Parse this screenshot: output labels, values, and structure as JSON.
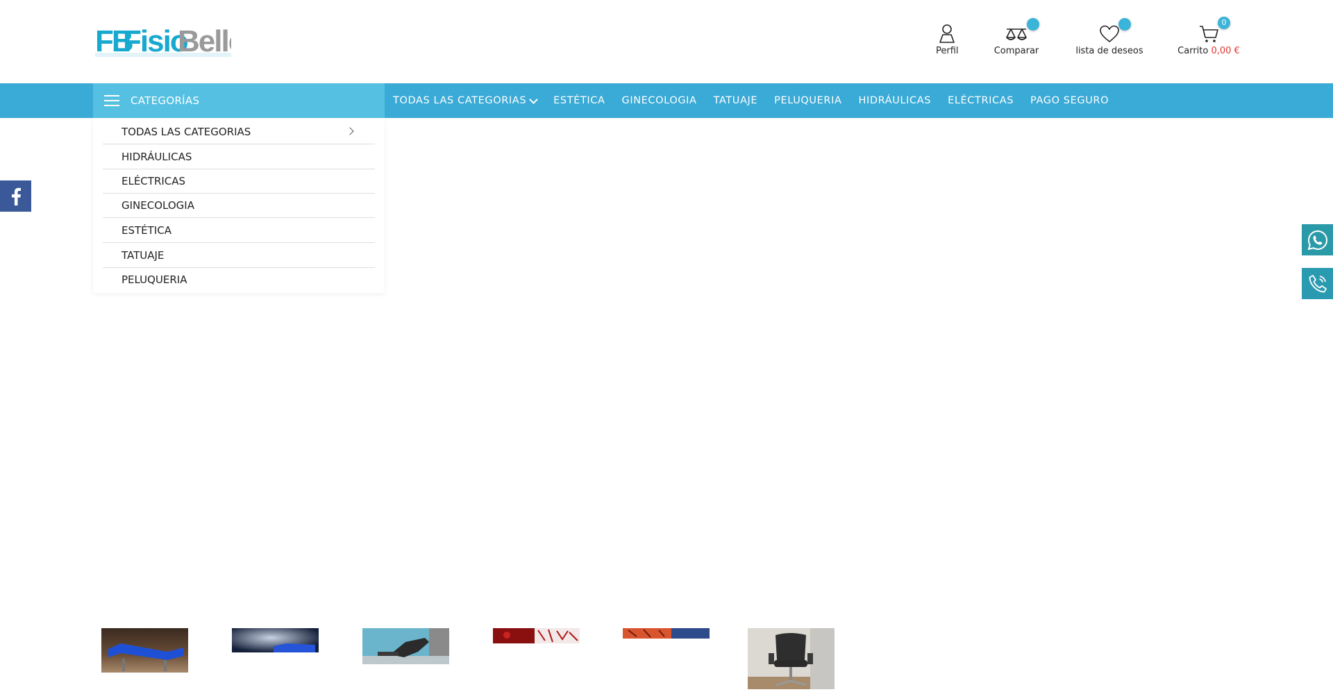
{
  "brand": {
    "logo_text_1": "FB",
    "logo_text_2": "Fisio",
    "logo_text_3": "Belle",
    "primary_color": "#3aaad6",
    "accent_color": "#55c0e2"
  },
  "header": {
    "profile_label": "Perfil",
    "compare_label": "Comparar",
    "wishlist_label": "lista de deseos",
    "cart_label": "Carrito",
    "cart_price": "0,00 €",
    "cart_count": "0"
  },
  "nav": {
    "categories_button": "CATEGORÍAS",
    "links": [
      {
        "label": "TODAS LAS CATEGORIAS",
        "has_dropdown": true
      },
      {
        "label": "ESTÉTICA"
      },
      {
        "label": "GINECOLOGIA"
      },
      {
        "label": "TATUAJE"
      },
      {
        "label": "PELUQUERIA"
      },
      {
        "label": "HIDRÁULICAS"
      },
      {
        "label": "ELÉCTRICAS"
      },
      {
        "label": "PAGO SEGURO"
      }
    ]
  },
  "dropdown": {
    "items": [
      {
        "label": "TODAS LAS CATEGORIAS",
        "has_submenu": true
      },
      {
        "label": "HIDRÁULICAS"
      },
      {
        "label": "ELÉCTRICAS"
      },
      {
        "label": "GINECOLOGIA"
      },
      {
        "label": "ESTÉTICA"
      },
      {
        "label": "TATUAJE"
      },
      {
        "label": "PELUQUERIA"
      }
    ]
  },
  "social": {
    "facebook_icon": "facebook-icon",
    "whatsapp_icon": "whatsapp-icon",
    "phone_icon": "phone-icon"
  },
  "thumbnails": [
    {
      "subject": "blue treatment table"
    },
    {
      "subject": "blue table on dark background"
    },
    {
      "subject": "black treatment chair in light blue room"
    },
    {
      "subject": "red tattoo artwork"
    },
    {
      "subject": "red and blue tattoo artwork"
    },
    {
      "subject": "black salon office chair"
    }
  ]
}
